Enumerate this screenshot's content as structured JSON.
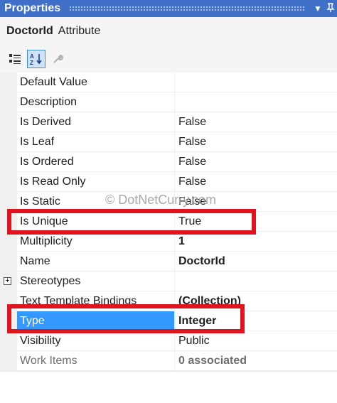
{
  "window": {
    "title": "Properties",
    "pin_icon": "pin-icon",
    "dropdown_icon": "dropdown-arrow-icon"
  },
  "object": {
    "name": "DoctorId",
    "type": "Attribute"
  },
  "toolbar": {
    "categorized_icon": "categorized-view-icon",
    "alphabetical_icon": "alphabetical-sort-icon",
    "property_pages_icon": "wrench-icon"
  },
  "properties": [
    {
      "label": "Default Value",
      "value": ""
    },
    {
      "label": "Description",
      "value": ""
    },
    {
      "label": "Is Derived",
      "value": "False"
    },
    {
      "label": "Is Leaf",
      "value": "False"
    },
    {
      "label": "Is Ordered",
      "value": "False"
    },
    {
      "label": "Is Read Only",
      "value": "False"
    },
    {
      "label": "Is Static",
      "value": "False"
    },
    {
      "label": "Is Unique",
      "value": "True"
    },
    {
      "label": "Multiplicity",
      "value": "1",
      "bold": true
    },
    {
      "label": "Name",
      "value": "DoctorId",
      "bold": true
    },
    {
      "label": "Stereotypes",
      "value": "",
      "expander": "+"
    },
    {
      "label": "Text Template Bindings",
      "value": "(Collection)",
      "bold": true
    },
    {
      "label": "Type",
      "value": "Integer",
      "bold": true,
      "selected": true
    },
    {
      "label": "Visibility",
      "value": "Public"
    },
    {
      "label": "Work Items",
      "value": "0 associated",
      "bold": true,
      "disabled": true
    }
  ],
  "watermark": "© DotNetCurry.com",
  "colors": {
    "title_bar": "#3f6fc6",
    "selection": "#3399ff",
    "highlight_box": "#e0141e"
  }
}
